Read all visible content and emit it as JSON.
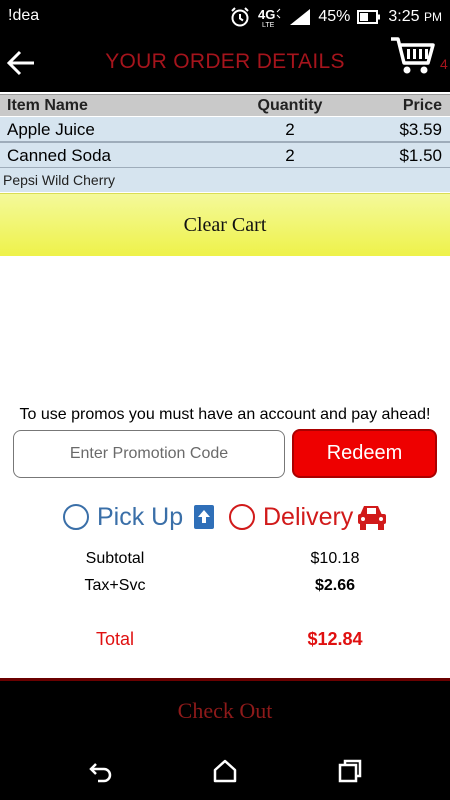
{
  "status_bar": {
    "carrier": "!dea",
    "network": "4G LTE",
    "battery": "45%",
    "time": "3:25",
    "ampm": "PM",
    "icons": [
      "alarm-icon",
      "signal-icon",
      "battery-icon"
    ]
  },
  "header": {
    "title": "YOUR ORDER DETAILS",
    "cart_count": "4",
    "title_color": "#a5141c"
  },
  "table": {
    "columns": [
      "Item Name",
      "Quantity",
      "Price"
    ],
    "rows": [
      {
        "name": "Apple Juice",
        "qty": "2",
        "price": "$3.59"
      },
      {
        "name": "Canned Soda",
        "qty": "2",
        "price": "$1.50",
        "note": "Pepsi Wild Cherry"
      }
    ]
  },
  "clear_cart_label": "Clear Cart",
  "promo": {
    "note": "To use promos you must have an account and pay ahead!",
    "placeholder": "Enter Promotion Code",
    "redeem_label": "Redeem"
  },
  "fulfillment": {
    "pickup_label": "Pick Up",
    "delivery_label": "Delivery",
    "pickup_color": "#3a6fa8",
    "delivery_color": "#d11a1a"
  },
  "totals": {
    "subtotal_label": "Subtotal",
    "subtotal_value": "$10.18",
    "tax_label": "Tax+Svc",
    "tax_value": "$2.66",
    "total_label": "Total",
    "total_value": "$12.84",
    "total_color": "#e01010"
  },
  "checkout_label": "Check Out",
  "nav": [
    "back-nav-icon",
    "home-nav-icon",
    "recents-nav-icon"
  ]
}
